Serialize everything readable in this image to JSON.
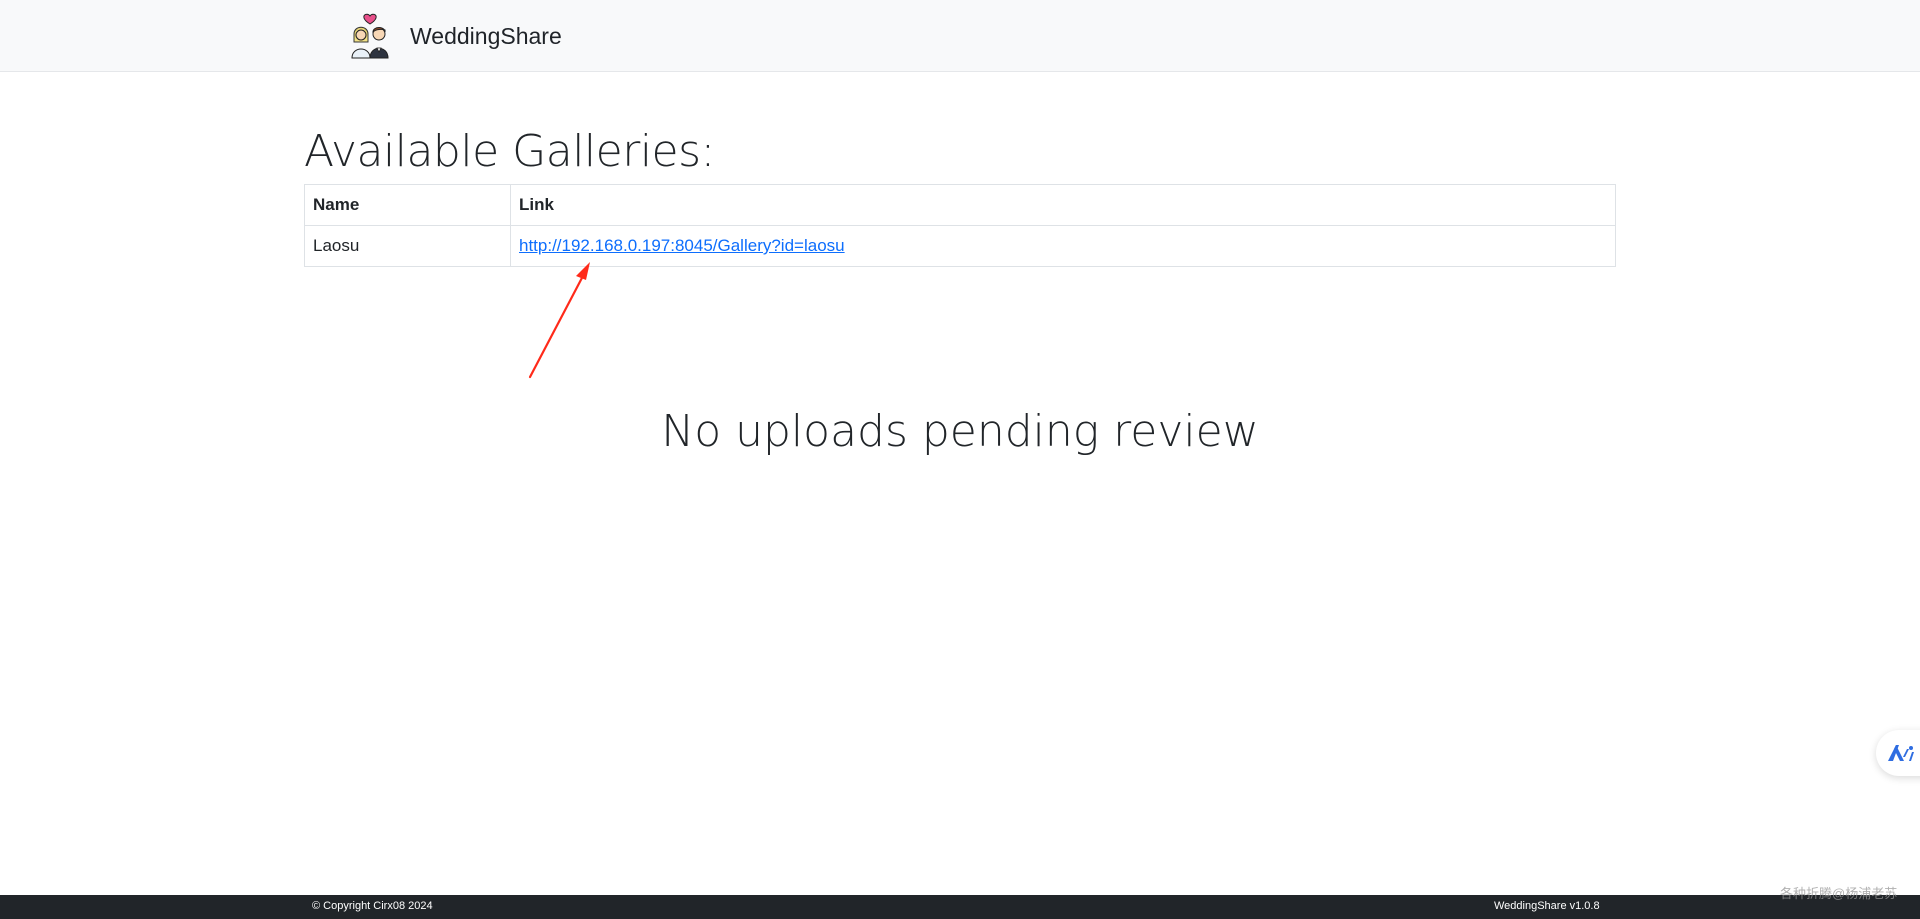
{
  "header": {
    "brand_name": "WeddingShare",
    "logo_icon": "couple-heart-icon"
  },
  "main": {
    "title": "Available Galleries:",
    "table": {
      "columns": [
        "Name",
        "Link"
      ],
      "rows": [
        {
          "name": "Laosu",
          "link": "http://192.168.0.197:8045/Gallery?id=laosu"
        }
      ]
    },
    "empty_message": "No uploads pending review"
  },
  "annotation": {
    "arrow_color": "#ff2a1a"
  },
  "floating_button": {
    "icon": "assistant-logo-icon",
    "color": "#2f6de1"
  },
  "footer": {
    "copyright": "© Copyright Cirx08 2024",
    "version": "WeddingShare v1.0.8"
  },
  "watermark": {
    "text": "各种折腾@杨浦老苏"
  },
  "colors": {
    "link": "#0d6efd",
    "footer_bg": "#212529",
    "header_bg": "#f8f9fa"
  }
}
